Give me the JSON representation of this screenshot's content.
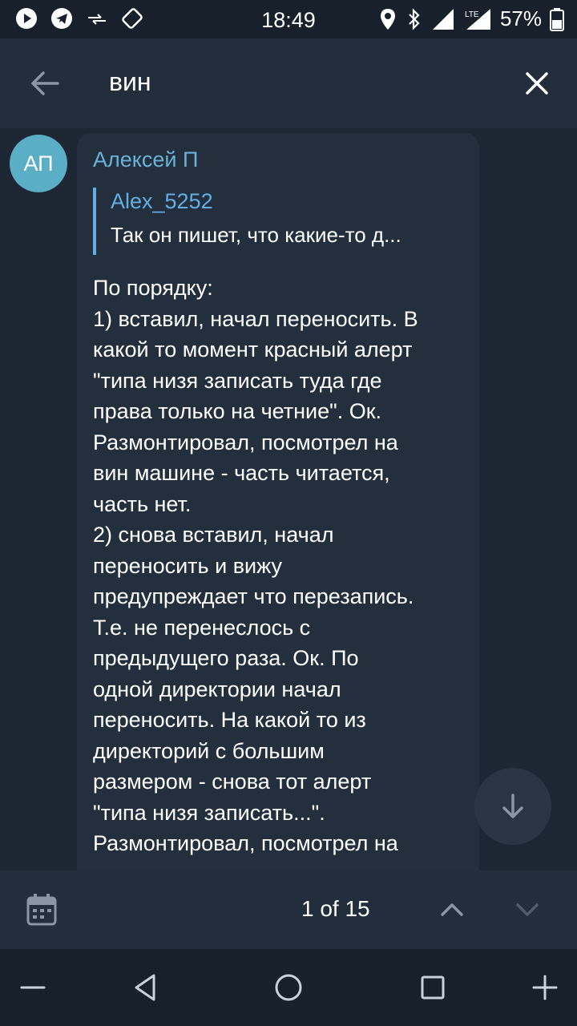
{
  "status_bar": {
    "time": "18:49",
    "battery": "57%",
    "icons": [
      "play-icon",
      "telegram-icon",
      "data-transfer-icon",
      "rotate-icon",
      "location-icon",
      "bluetooth-icon",
      "signal-icon",
      "lte-signal-icon",
      "battery-icon"
    ]
  },
  "header": {
    "search_query": "вин",
    "back_icon": "arrow-left-icon",
    "close_icon": "close-icon"
  },
  "message": {
    "avatar_initials": "АП",
    "author": "Алексей П",
    "reply": {
      "name": "Alex_5252",
      "text": "Так он пишет, что какие-то д..."
    },
    "lines": [
      "По порядку:",
      "1) вставил, начал переносить. В",
      "какой то момент красный алерт",
      "\"типа низя записать туда где",
      "права только на четние\". Ок.",
      "Размонтировал, посмотрел на",
      "вин машине - часть читается,",
      "часть нет.",
      "2) снова вставил, начал",
      "переносить и вижу",
      "предупреждает что перезапись.",
      "Т.е. не перенеслось с",
      "предыдущего раза. Ок. По",
      "одной директории начал",
      "переносить. На какой то из",
      "директорий с большим",
      "размером - снова тот алерт",
      "\"типа низя записать...\".",
      "Размонтировал, посмотрел на"
    ]
  },
  "search_nav": {
    "counter": "1 of 15",
    "calendar_icon": "calendar-icon",
    "up_icon": "chevron-up-icon",
    "down_icon": "chevron-down-icon"
  },
  "colors": {
    "background": "#1d2733",
    "header": "#232e3c",
    "bubble": "#242f3d",
    "accent": "#62aee5",
    "author": "#6ab2d9",
    "avatar": "#5aaec6"
  }
}
